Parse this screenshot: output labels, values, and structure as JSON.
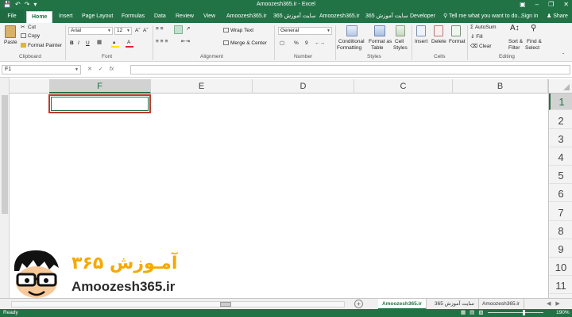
{
  "window": {
    "title": "Amoozesh365.ir - Excel"
  },
  "colors": {
    "excel_green": "#217346",
    "selection_red": "#c0392b",
    "brand_orange": "#f6a800"
  },
  "ribbon_tabs": [
    "File",
    "Home",
    "Insert",
    "Page Layout",
    "Formulas",
    "Data",
    "Review",
    "View",
    "Amoozesh365.ir",
    "سایت آموزش 365",
    "Amoozesh365.ir",
    "سایت آموزش 365",
    "Developer"
  ],
  "tell_me": "Tell me what you want to do...",
  "sign_in": "Sign in",
  "share": "Share",
  "clipboard": {
    "paste": "Paste",
    "cut": "Cut",
    "copy": "Copy",
    "format_painter": "Format Painter",
    "label": "Clipboard"
  },
  "font": {
    "name": "Arial",
    "size": "12",
    "label": "Font",
    "bold": "B",
    "italic": "I",
    "underline": "U"
  },
  "alignment": {
    "wrap_text": "Wrap Text",
    "merge_center": "Merge & Center",
    "label": "Alignment"
  },
  "number": {
    "format": "General",
    "percent": "%",
    "comma": "9",
    "label": "Number"
  },
  "styles": {
    "conditional_formatting": [
      "Conditional",
      "Formatting"
    ],
    "format_as_table": [
      "Format as",
      "Table"
    ],
    "cell_styles": [
      "Cell",
      "Styles"
    ],
    "label": "Styles"
  },
  "cells": {
    "insert": "Insert",
    "delete": "Delete",
    "format": "Format",
    "label": "Cells"
  },
  "editing": {
    "autosum": "AutoSum",
    "fill": "Fill",
    "clear": "Clear",
    "sort_filter": [
      "Sort &",
      "Filter"
    ],
    "find_select": [
      "Find &",
      "Select"
    ],
    "label": "Editing"
  },
  "name_box": "F1",
  "fx": "fx",
  "columns": [
    "F",
    "E",
    "D",
    "C",
    "B"
  ],
  "selected_column": "F",
  "rows": [
    "1",
    "2",
    "3",
    "4",
    "5",
    "6",
    "7",
    "8",
    "9",
    "10",
    "11"
  ],
  "selected_row": "1",
  "sheets": [
    "Amoozesh365.ir",
    "365 سایت آموزش",
    "Amoozesh365.ir"
  ],
  "active_sheet_index": 0,
  "status": {
    "ready": "Ready",
    "zoom": "190%"
  },
  "watermark": {
    "brand_text": "آمـوزش ۳۶۵",
    "domain": "Amoozesh365.ir"
  }
}
